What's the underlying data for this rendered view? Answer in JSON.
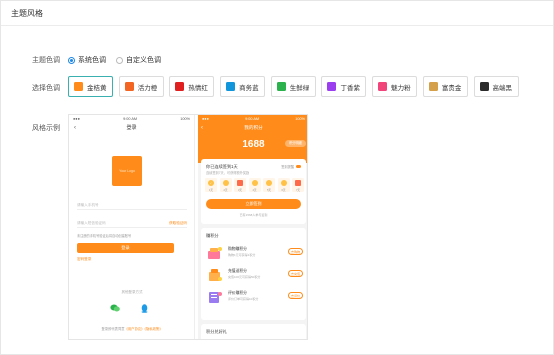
{
  "page": {
    "title": "主题风格"
  },
  "theme_mode": {
    "label": "主题色调",
    "options": [
      {
        "label": "系统色调",
        "selected": true
      },
      {
        "label": "自定义色调",
        "selected": false
      }
    ]
  },
  "color_select": {
    "label": "选择色调",
    "swatches": [
      {
        "label": "金桔黄",
        "color": "#ff8c1a",
        "active": true
      },
      {
        "label": "活力橙",
        "color": "#f26522",
        "active": false
      },
      {
        "label": "热情红",
        "color": "#e02020",
        "active": false
      },
      {
        "label": "商务蓝",
        "color": "#1296db",
        "active": false
      },
      {
        "label": "生鲜绿",
        "color": "#2bb24c",
        "active": false
      },
      {
        "label": "丁香紫",
        "color": "#9b3ef0",
        "active": false
      },
      {
        "label": "魅力粉",
        "color": "#f0447a",
        "active": false
      },
      {
        "label": "富贵金",
        "color": "#d4a04a",
        "active": false
      },
      {
        "label": "高端黑",
        "color": "#2b2b2b",
        "active": false
      }
    ]
  },
  "preview": {
    "label": "风格示例",
    "login": {
      "status_time": "9:00 AM",
      "status_battery": "100%",
      "title": "登录",
      "logo_text": "Your Logo",
      "phone_placeholder": "请输入手机号",
      "code_placeholder": "请输入短信验证码",
      "code_link": "获取验证码",
      "hint": "未注册的手机号验证后将自动创建账号",
      "login_button": "登录",
      "password_login": "密码登录",
      "other_login": "其他登录方式",
      "agreement_prefix": "登录即代表同意",
      "agreement_link": "《用户协议》《隐私政策》"
    },
    "points": {
      "status_time": "9:00 AM",
      "status_battery": "100%",
      "title": "我的积分",
      "points_value": "1688",
      "detail_pill": "积分明细",
      "sign_title": "你已连续签到1天",
      "sign_sub": "连续签到7天，可获得额外奖励",
      "sign_toggle": "签到提醒",
      "days": [
        "1天",
        "2天",
        "3天",
        "4天",
        "5天",
        "6天",
        "7天"
      ],
      "sign_button": "立即签到",
      "sign_footer": "已有1568人参与签到",
      "earn_title": "赚积分",
      "tasks": [
        {
          "name": "购物赚积分",
          "desc": "购物1元可获得1积分",
          "button": "去购物"
        },
        {
          "name": "充值送积分",
          "desc": "充值100元可获得50积分",
          "button": "去充值"
        },
        {
          "name": "评价赚积分",
          "desc": "评价订单可获得10积分",
          "button": "去评价"
        }
      ],
      "exchange_title": "积分兑好礼"
    }
  }
}
